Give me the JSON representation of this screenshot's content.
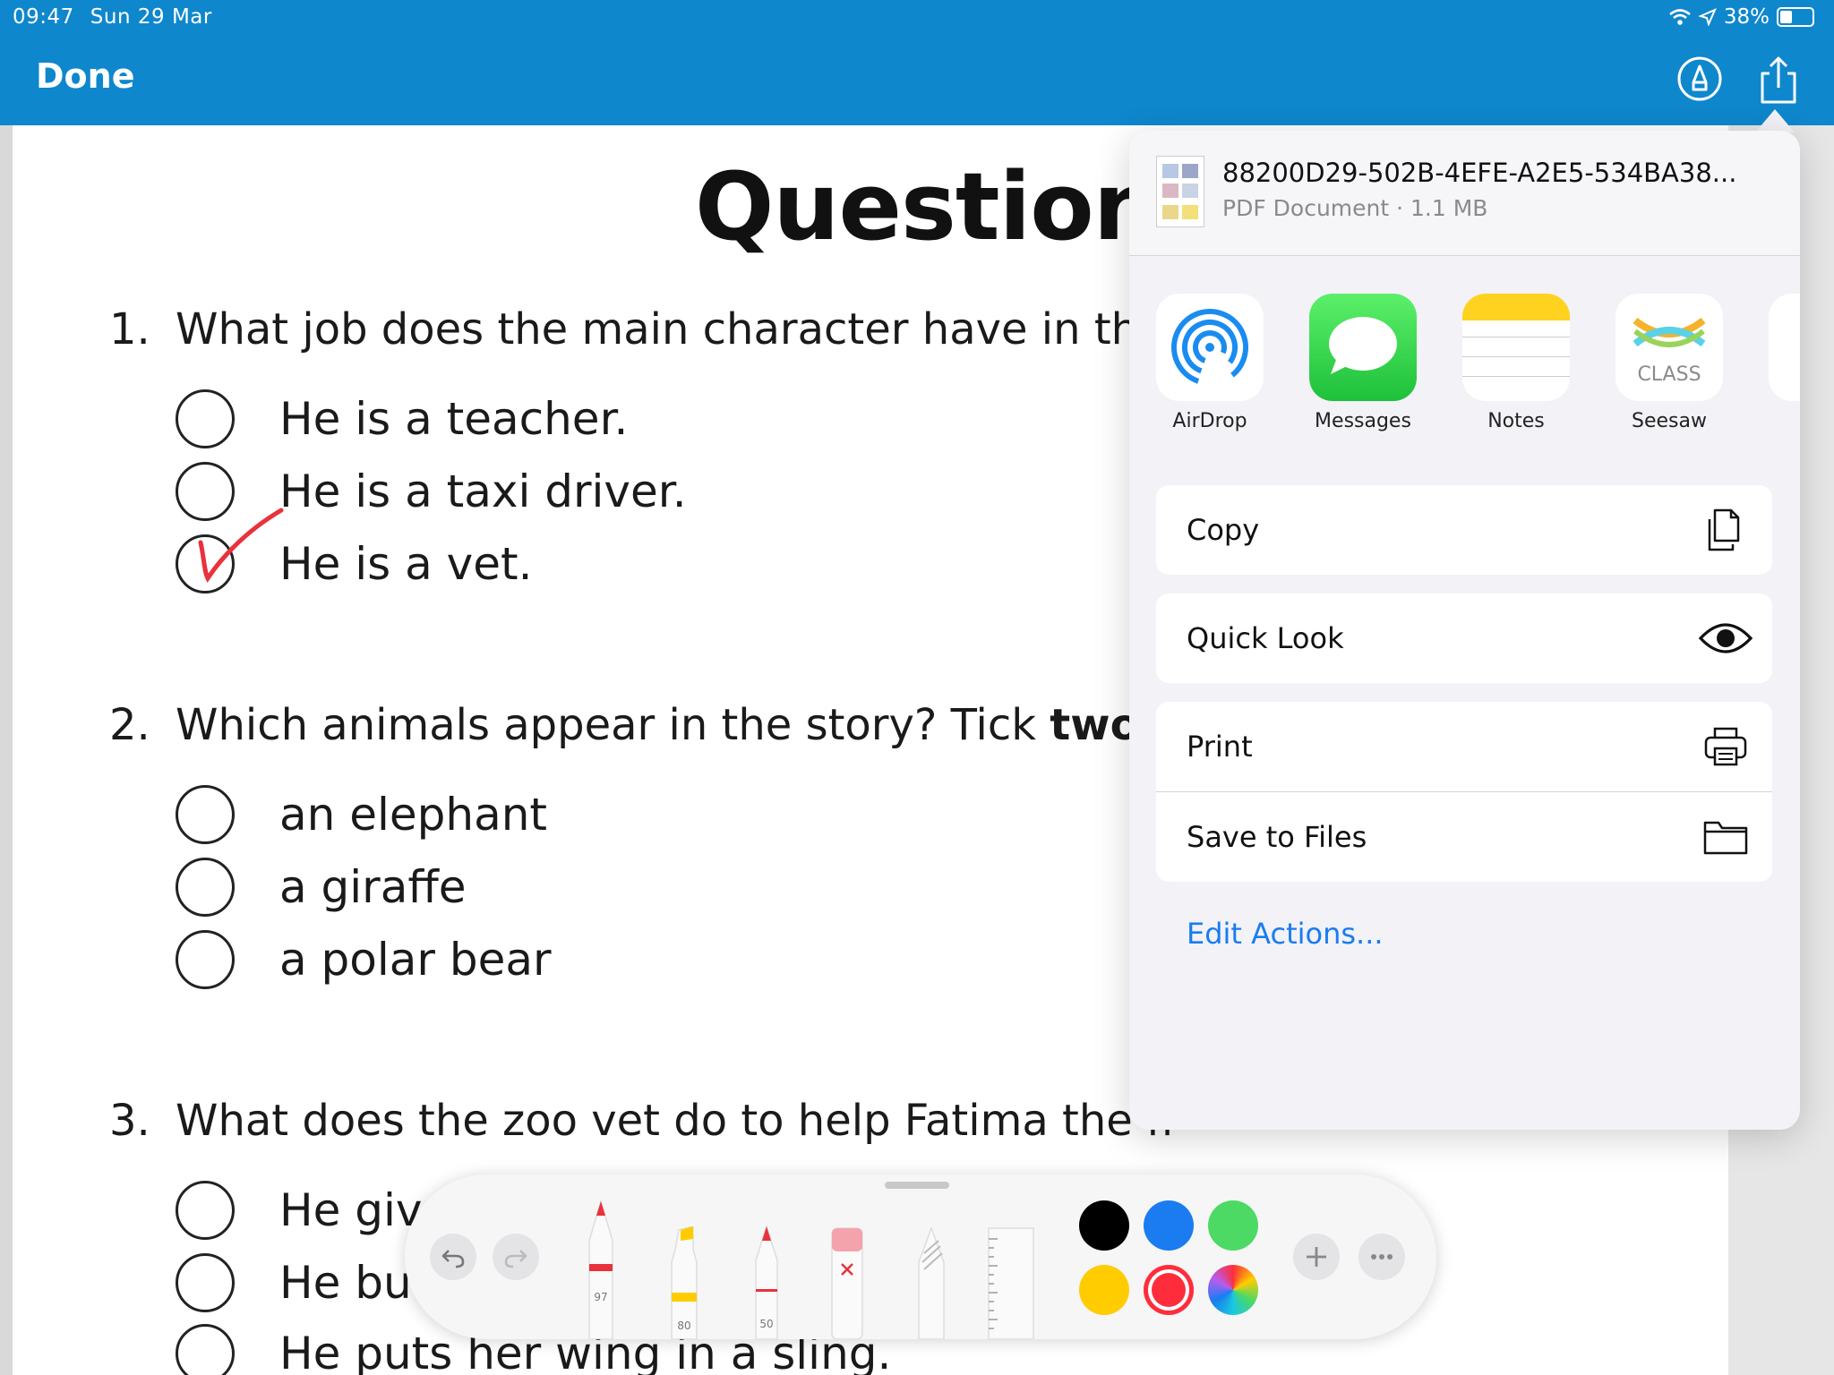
{
  "status_bar": {
    "time": "09:47",
    "date": "Sun 29 Mar",
    "battery": "38%",
    "battery_level": 0.38
  },
  "nav": {
    "done_label": "Done",
    "markup_icon": "markup-pen-icon",
    "share_icon": "share-icon"
  },
  "document": {
    "title": "Questions",
    "questions": [
      {
        "num": "1.",
        "text": "What job does the main character have in the",
        "options": [
          "He is a teacher.",
          "He is a taxi driver.",
          "He is a vet."
        ]
      },
      {
        "num": "2.",
        "text": "Which animals appear in the story? Tick",
        "bold": "two",
        "options": [
          "an elephant",
          "a giraffe",
          "a polar bear"
        ]
      },
      {
        "num": "3.",
        "text": "What does the zoo vet do to help Fatima the fl",
        "options": [
          "He giv",
          "He bu",
          "He puts her wing in a sling."
        ]
      }
    ]
  },
  "share_sheet": {
    "file_name": "88200D29-502B-4EFE-A2E5-534BA38...",
    "file_meta": "PDF Document · 1.1 MB",
    "apps": [
      {
        "label": "AirDrop",
        "icon": "airdrop-icon"
      },
      {
        "label": "Messages",
        "icon": "messages-icon"
      },
      {
        "label": "Notes",
        "icon": "notes-icon"
      },
      {
        "label": "Seesaw",
        "icon": "seesaw-icon",
        "badge": "CLASS"
      }
    ],
    "actions": [
      {
        "label": "Copy",
        "icon": "copy-icon"
      },
      {
        "label": "Quick Look",
        "icon": "eye-icon"
      },
      {
        "label": "Print",
        "icon": "printer-icon"
      },
      {
        "label": "Save to Files",
        "icon": "folder-icon"
      }
    ],
    "edit_actions": "Edit Actions..."
  },
  "markup_toolbar": {
    "tools": [
      {
        "name": "pen",
        "value": "97"
      },
      {
        "name": "highlighter",
        "value": "80"
      },
      {
        "name": "pencil",
        "value": "50"
      },
      {
        "name": "eraser",
        "value": ""
      },
      {
        "name": "lasso",
        "value": ""
      },
      {
        "name": "ruler",
        "value": ""
      }
    ],
    "colors": [
      "#000000",
      "#1a7cf0",
      "#4cd964",
      "#ffcc00",
      "#ff2d3b"
    ],
    "selected_color": "#ff2d3b"
  }
}
